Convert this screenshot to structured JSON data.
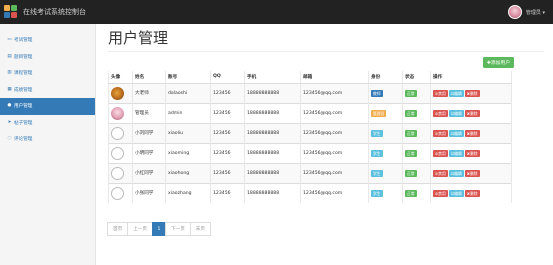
{
  "header": {
    "title": "在线考试系统控制台",
    "admin_name": "管理员 ▾"
  },
  "sidebar": {
    "items": [
      {
        "label": "考试管理",
        "icon": "monitor-icon"
      },
      {
        "label": "题目管理",
        "icon": "file-icon"
      },
      {
        "label": "课程管理",
        "icon": "book-icon"
      },
      {
        "label": "成绩管理",
        "icon": "chart-icon"
      },
      {
        "label": "用户管理",
        "icon": "user-icon",
        "active": true
      },
      {
        "label": "帖子管理",
        "icon": "send-icon"
      },
      {
        "label": "评论管理",
        "icon": "comment-icon"
      }
    ]
  },
  "main": {
    "title": "用户管理",
    "add_button": "✚添加用户",
    "columns": [
      "头像",
      "姓名",
      "账号",
      "QQ",
      "手机",
      "邮箱",
      "身份",
      "状态",
      "操作"
    ],
    "rows": [
      {
        "name": "大老师",
        "account": "dalaoshi",
        "qq": "123456",
        "phone": "18888888888",
        "email": "123456@qq.com",
        "role": "教师",
        "role_type": "teacher",
        "status": "正常",
        "avatar": "bird"
      },
      {
        "name": "管理员",
        "account": "admin",
        "qq": "123456",
        "phone": "18888888888",
        "email": "123456@qq.com",
        "role": "管理员",
        "role_type": "admin",
        "status": "正常",
        "avatar": "girl"
      },
      {
        "name": "小刘同学",
        "account": "xiaoliu",
        "qq": "123456",
        "phone": "18888888888",
        "email": "123456@qq.com",
        "role": "学生",
        "role_type": "student",
        "status": "正常",
        "avatar": "default"
      },
      {
        "name": "小明同学",
        "account": "xiaoming",
        "qq": "123456",
        "phone": "18888888888",
        "email": "123456@qq.com",
        "role": "学生",
        "role_type": "student",
        "status": "正常",
        "avatar": "default"
      },
      {
        "name": "小红同学",
        "account": "xiaohong",
        "qq": "123456",
        "phone": "18888888888",
        "email": "123456@qq.com",
        "role": "学生",
        "role_type": "student",
        "status": "正常",
        "avatar": "default"
      },
      {
        "name": "小张同学",
        "account": "xiaozhang",
        "qq": "123456",
        "phone": "18888888888",
        "email": "123456@qq.com",
        "role": "学生",
        "role_type": "student",
        "status": "正常",
        "avatar": "default"
      }
    ],
    "actions": {
      "disable": "⊘禁用",
      "edit": "☑编辑",
      "delete": "✖删除"
    }
  },
  "pagination": {
    "first": "首页",
    "prev": "上一页",
    "current": "1",
    "next": "下一页",
    "last": "末页"
  },
  "colors": {
    "nav_bg": "#222222",
    "primary": "#337ab7",
    "success": "#5cb85c",
    "danger": "#d9534f",
    "info": "#5bc0de",
    "warning": "#f0ad4e"
  }
}
